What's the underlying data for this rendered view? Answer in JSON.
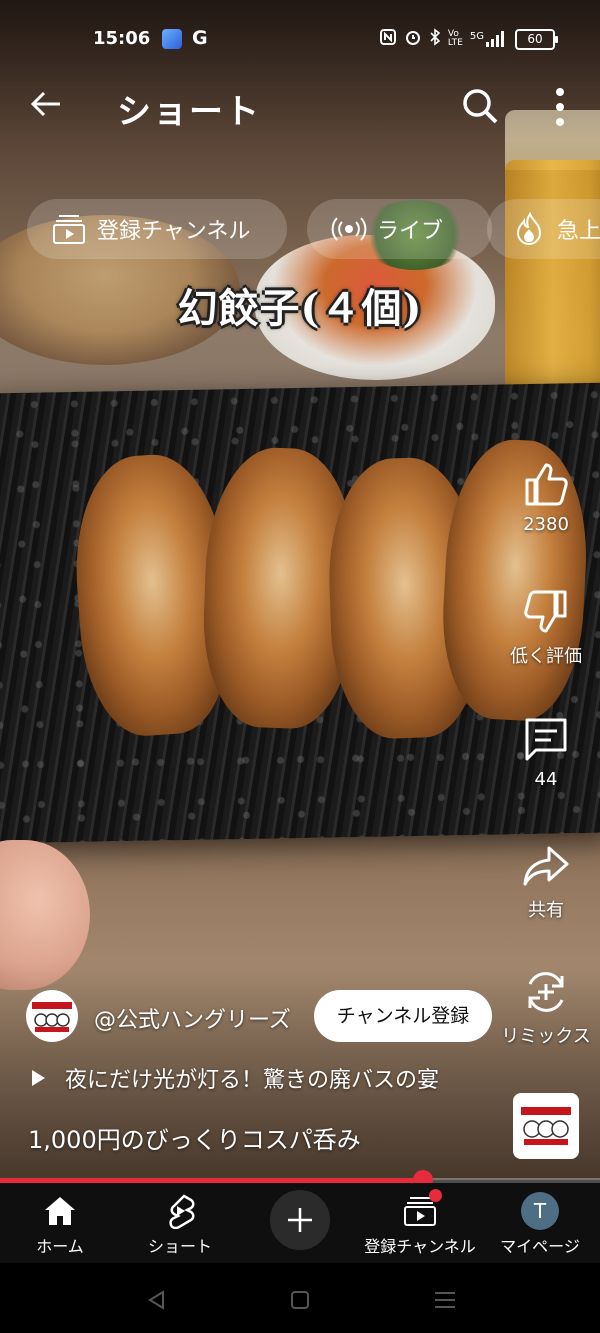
{
  "status_bar": {
    "time": "15:06",
    "network": "5G",
    "battery": "60"
  },
  "header": {
    "title": "ショート"
  },
  "chips": [
    {
      "label": "登録チャンネル",
      "icon": "subscriptions-icon"
    },
    {
      "label": "ライブ",
      "icon": "live-icon"
    },
    {
      "label": "急上",
      "icon": "trending-icon"
    }
  ],
  "video": {
    "caption": "幻餃子(４個)"
  },
  "actions": {
    "like_count": "2380",
    "dislike_label": "低く評価",
    "comment_count": "44",
    "share_label": "共有",
    "remix_label": "リミックス"
  },
  "channel": {
    "handle": "@公式ハングリーズ",
    "subscribe_label": "チャンネル登録"
  },
  "playlist": {
    "title": "夜にだけ光が灯る！驚きの廃バスの宴"
  },
  "video_title": "1,000円のびっくりコスパ呑み",
  "progress": {
    "fraction": 0.705
  },
  "nav": {
    "home": "ホーム",
    "shorts": "ショート",
    "subscriptions": "登録チャンネル",
    "you": "マイページ",
    "user_initial": "T"
  },
  "colors": {
    "accent": "#e62b3c",
    "nav_bg": "#0f0f0f"
  }
}
